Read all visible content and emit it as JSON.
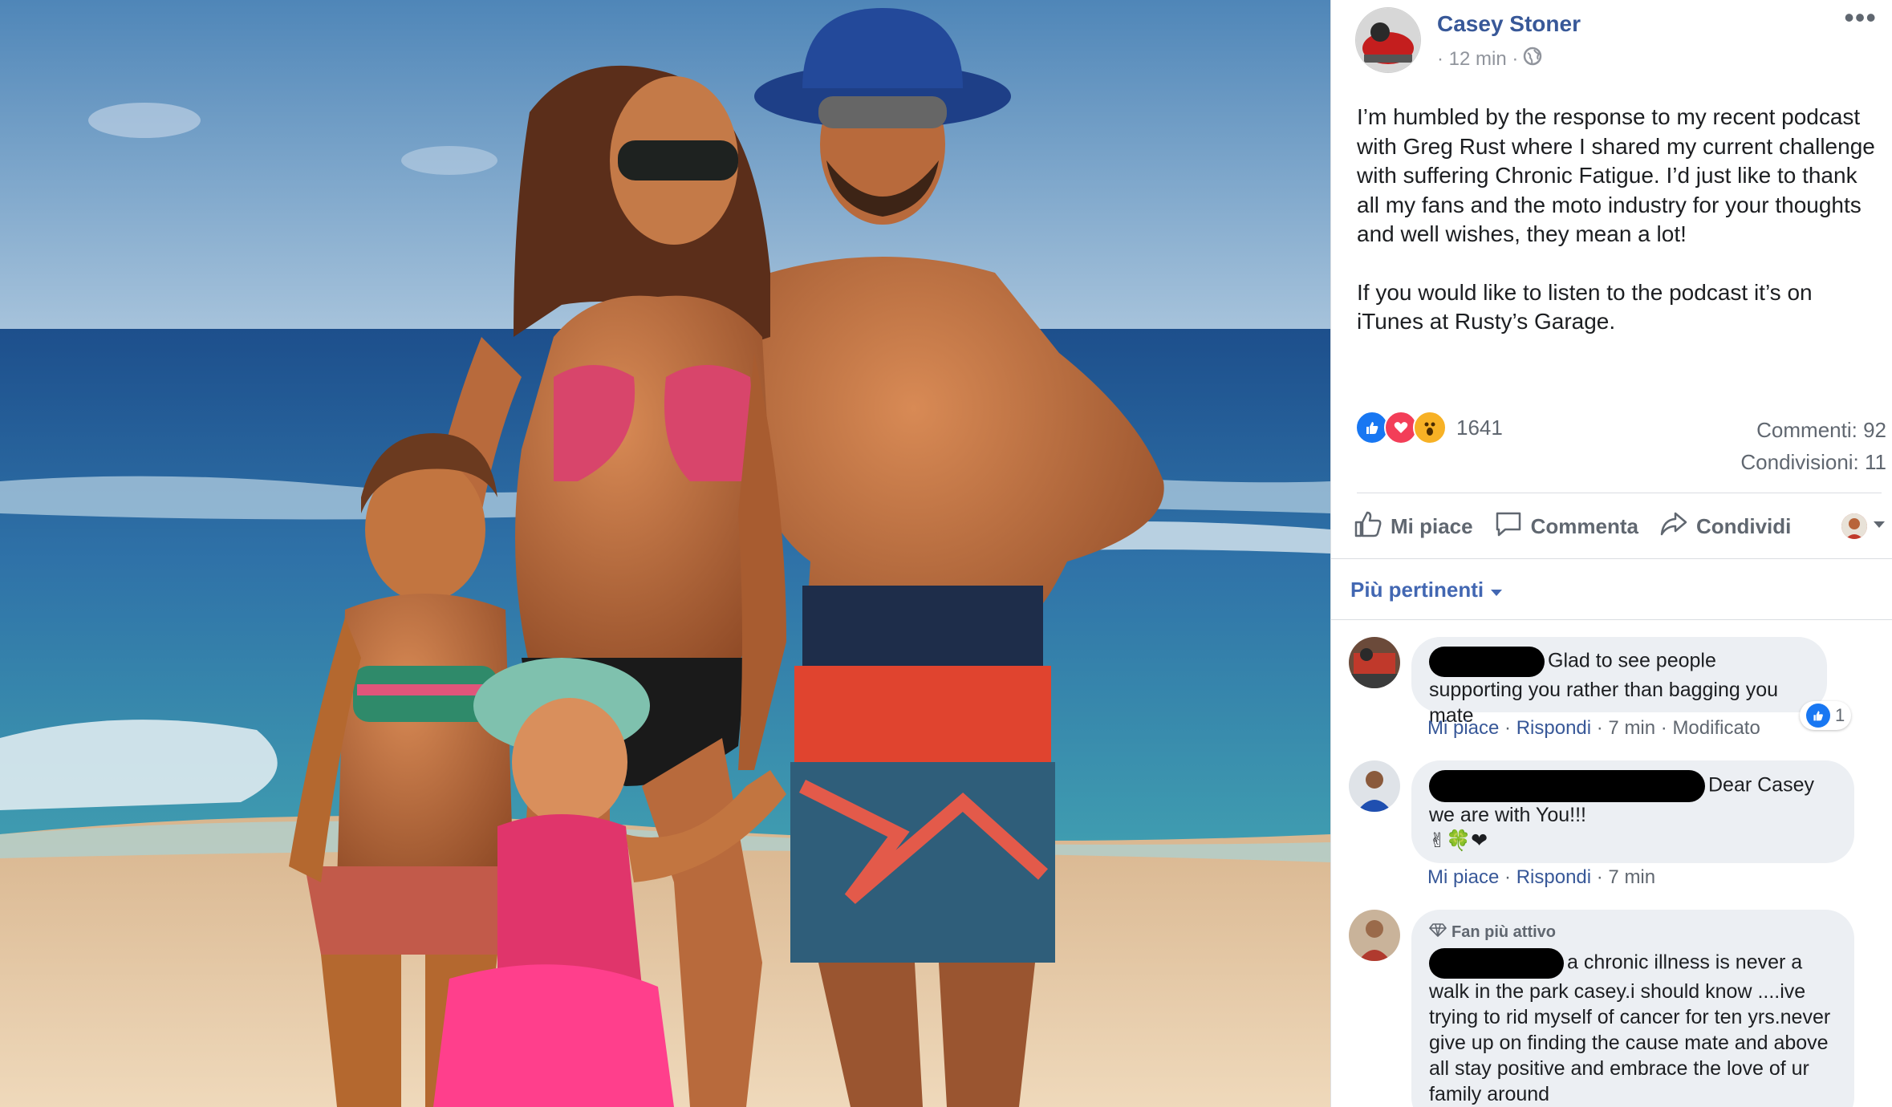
{
  "post": {
    "author": "Casey Stoner",
    "time": "· 12 min ·",
    "paragraph_1": "I’m humbled by the response to my recent podcast with Greg Rust where I shared my current challenge with suffering Chronic Fatigue. I’d just like to thank all my fans and the moto industry for your thoughts and well wishes, they mean a lot!",
    "paragraph_2": "If you would like to listen to the podcast it’s on iTunes at Rusty’s Garage.",
    "reaction_count": "1641",
    "comments_count": "Commenti: 92",
    "shares_count": "Condivisioni: 11"
  },
  "actions": {
    "like": "Mi piace",
    "comment": "Commenta",
    "share": "Condividi"
  },
  "filter_label": "Più pertinenti",
  "comments": [
    {
      "text": "Glad to see people supporting you rather than bagging you mate",
      "like": "Mi piace",
      "reply": "Rispondi",
      "time": "7 min",
      "edited": "Modificato",
      "likes": "1"
    },
    {
      "text_line1": "Dear Casey",
      "text_line2": "we are with You!!!",
      "emoji": "✌🍀❤",
      "like": "Mi piace",
      "reply": "Rispondi",
      "time": "7 min"
    },
    {
      "badge": "Fan più attivo",
      "text_line1": "a chronic illness is never a",
      "text_rest": "walk in the park casey.i should know ....ive trying to rid myself of cancer for ten yrs.never give up on finding the cause mate and above all stay positive and embrace the love of ur family around"
    }
  ],
  "colors": {
    "link": "#385898",
    "accent": "#4267b2",
    "like_blue": "#1877f2",
    "love_red": "#f33e58",
    "wow_yellow": "#f7b125"
  },
  "icons": [
    "globe-icon",
    "more-icon",
    "like-icon",
    "comment-icon",
    "share-icon",
    "dropdown-icon",
    "diamond-icon"
  ]
}
